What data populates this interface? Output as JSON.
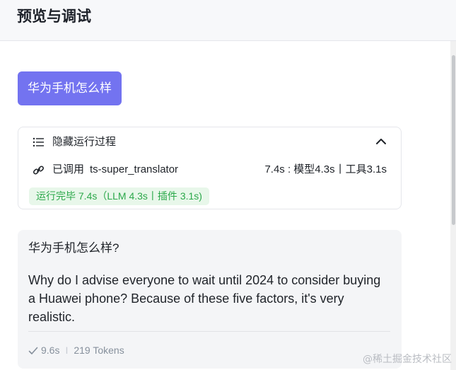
{
  "header": {
    "title": "预览与调试"
  },
  "user_message": {
    "text": "华为手机怎么样"
  },
  "run_panel": {
    "toggle_label": "隐藏运行过程",
    "tool_prefix": "已调用",
    "tool_name": "ts-super_translator",
    "timing": "7.4s : 模型4.3s丨工具3.1s",
    "status": "运行完毕 7.4s（LLM 4.3s丨插件 3.1s)"
  },
  "answer": {
    "question": "华为手机怎么样?",
    "text": "Why do I advise everyone to wait until 2024 to consider buying a Huawei phone? Because of these five factors, it's very realistic.",
    "duration": "9.6s",
    "separator": "I",
    "tokens": "219 Tokens"
  },
  "watermark": "@稀土掘金技术社区",
  "colors": {
    "accent": "#7373f0",
    "success": "#2ba84a",
    "success_bg": "#e8f7ea",
    "muted": "#86909c"
  },
  "icons": [
    "list-icon",
    "chevron-up-icon",
    "link-icon",
    "check-icon"
  ]
}
